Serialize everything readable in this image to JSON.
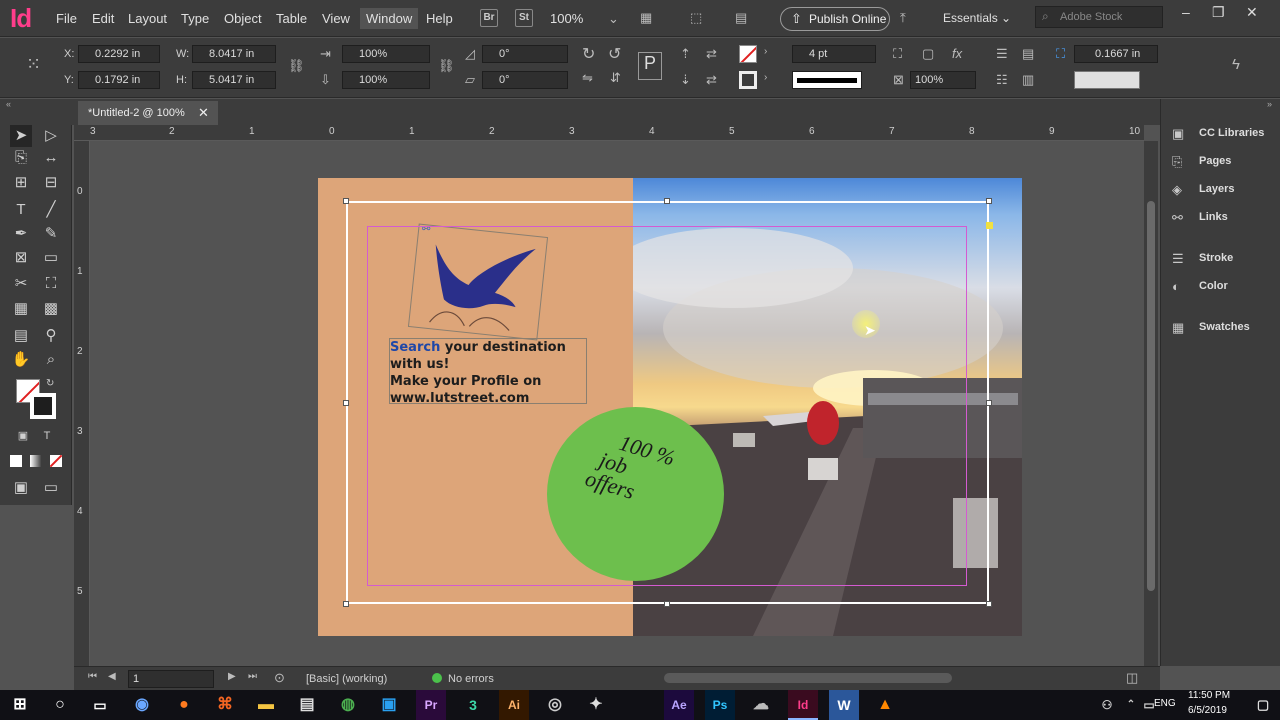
{
  "app": {
    "logo": "Id",
    "menus": [
      "File",
      "Edit",
      "Layout",
      "Type",
      "Object",
      "Table",
      "View",
      "Window",
      "Help"
    ],
    "active_menu": "Window",
    "bridge_label": "Br",
    "stock_label": "St",
    "zoom": "100%",
    "publish_label": "Publish Online",
    "workspace": "Essentials",
    "search_placeholder": "Adobe Stock"
  },
  "control_panel": {
    "x_label": "X:",
    "x_value": "0.2292 in",
    "y_label": "Y:",
    "y_value": "0.1792 in",
    "w_label": "W:",
    "w_value": "8.0417 in",
    "h_label": "H:",
    "h_value": "5.0417 in",
    "scale_x": "100%",
    "scale_y": "100%",
    "rotate": "0°",
    "shear": "0°",
    "stroke_weight": "4 pt",
    "opacity": "100%",
    "offset": "0.1667 in"
  },
  "document_tab": "*Untitled-2 @ 100%",
  "ruler_h": [
    "3",
    "2",
    "1",
    "0",
    "1",
    "2",
    "3",
    "4",
    "5",
    "6",
    "7",
    "8",
    "9",
    "10"
  ],
  "ruler_v": [
    "0",
    "1",
    "2",
    "3",
    "4",
    "5"
  ],
  "artwork": {
    "headline_keyword": "Search",
    "headline_rest": " your destination with us!",
    "line2": "Make your Profile on",
    "line3": "www.lutstreet.com",
    "badge_line1": "100 %",
    "badge_line2": "job",
    "badge_line3": "offers"
  },
  "panels": [
    "CC Libraries",
    "Pages",
    "Layers",
    "Links",
    "Stroke",
    "Color",
    "Swatches"
  ],
  "status": {
    "page": "1",
    "style": "[Basic] (working)",
    "errors": "No errors"
  },
  "taskbar": {
    "lang": "ENG",
    "time": "11:50 PM",
    "date": "6/5/2019",
    "apps": [
      "Pr",
      "Ai",
      "Ae",
      "Ps",
      "Id"
    ]
  },
  "colors": {
    "indesign_pink": "#ff3d8b",
    "tan_bg": "#dda579",
    "green_circle": "#6dbf4d",
    "keyword_blue": "#1f47a8"
  }
}
